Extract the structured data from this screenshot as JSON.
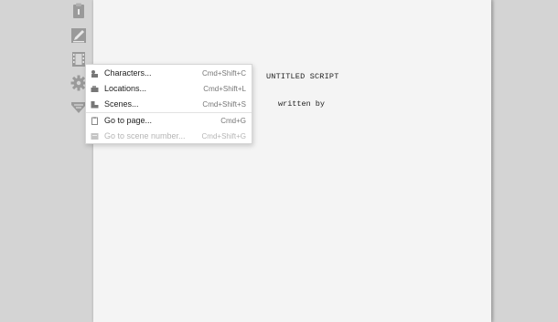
{
  "script": {
    "title": "UNTITLED SCRIPT",
    "written_by": "written by"
  },
  "toolbar": {
    "tools": [
      {
        "icon": "clipboard-icon"
      },
      {
        "icon": "pencil-icon"
      },
      {
        "icon": "film-strip-icon"
      },
      {
        "icon": "gear-icon"
      },
      {
        "icon": "bookmark-icon"
      }
    ]
  },
  "menu": {
    "items": [
      {
        "label": "Characters...",
        "shortcut": "Cmd+Shift+C",
        "icon": "characters-icon",
        "enabled": true
      },
      {
        "label": "Locations...",
        "shortcut": "Cmd+Shift+L",
        "icon": "locations-icon",
        "enabled": true
      },
      {
        "label": "Scenes...",
        "shortcut": "Cmd+Shift+S",
        "icon": "scenes-icon",
        "enabled": true
      },
      {
        "label": "Go to page...",
        "shortcut": "Cmd+G",
        "icon": "page-icon",
        "enabled": true
      },
      {
        "label": "Go to scene number...",
        "shortcut": "Cmd+Shift+G",
        "icon": "scene-number-icon",
        "enabled": false
      }
    ]
  },
  "colors": {
    "background": "#d4d4d4",
    "page": "#f4f4f4",
    "icon": "#9a9a9a",
    "menu_disabled": "#b5b5b5"
  }
}
